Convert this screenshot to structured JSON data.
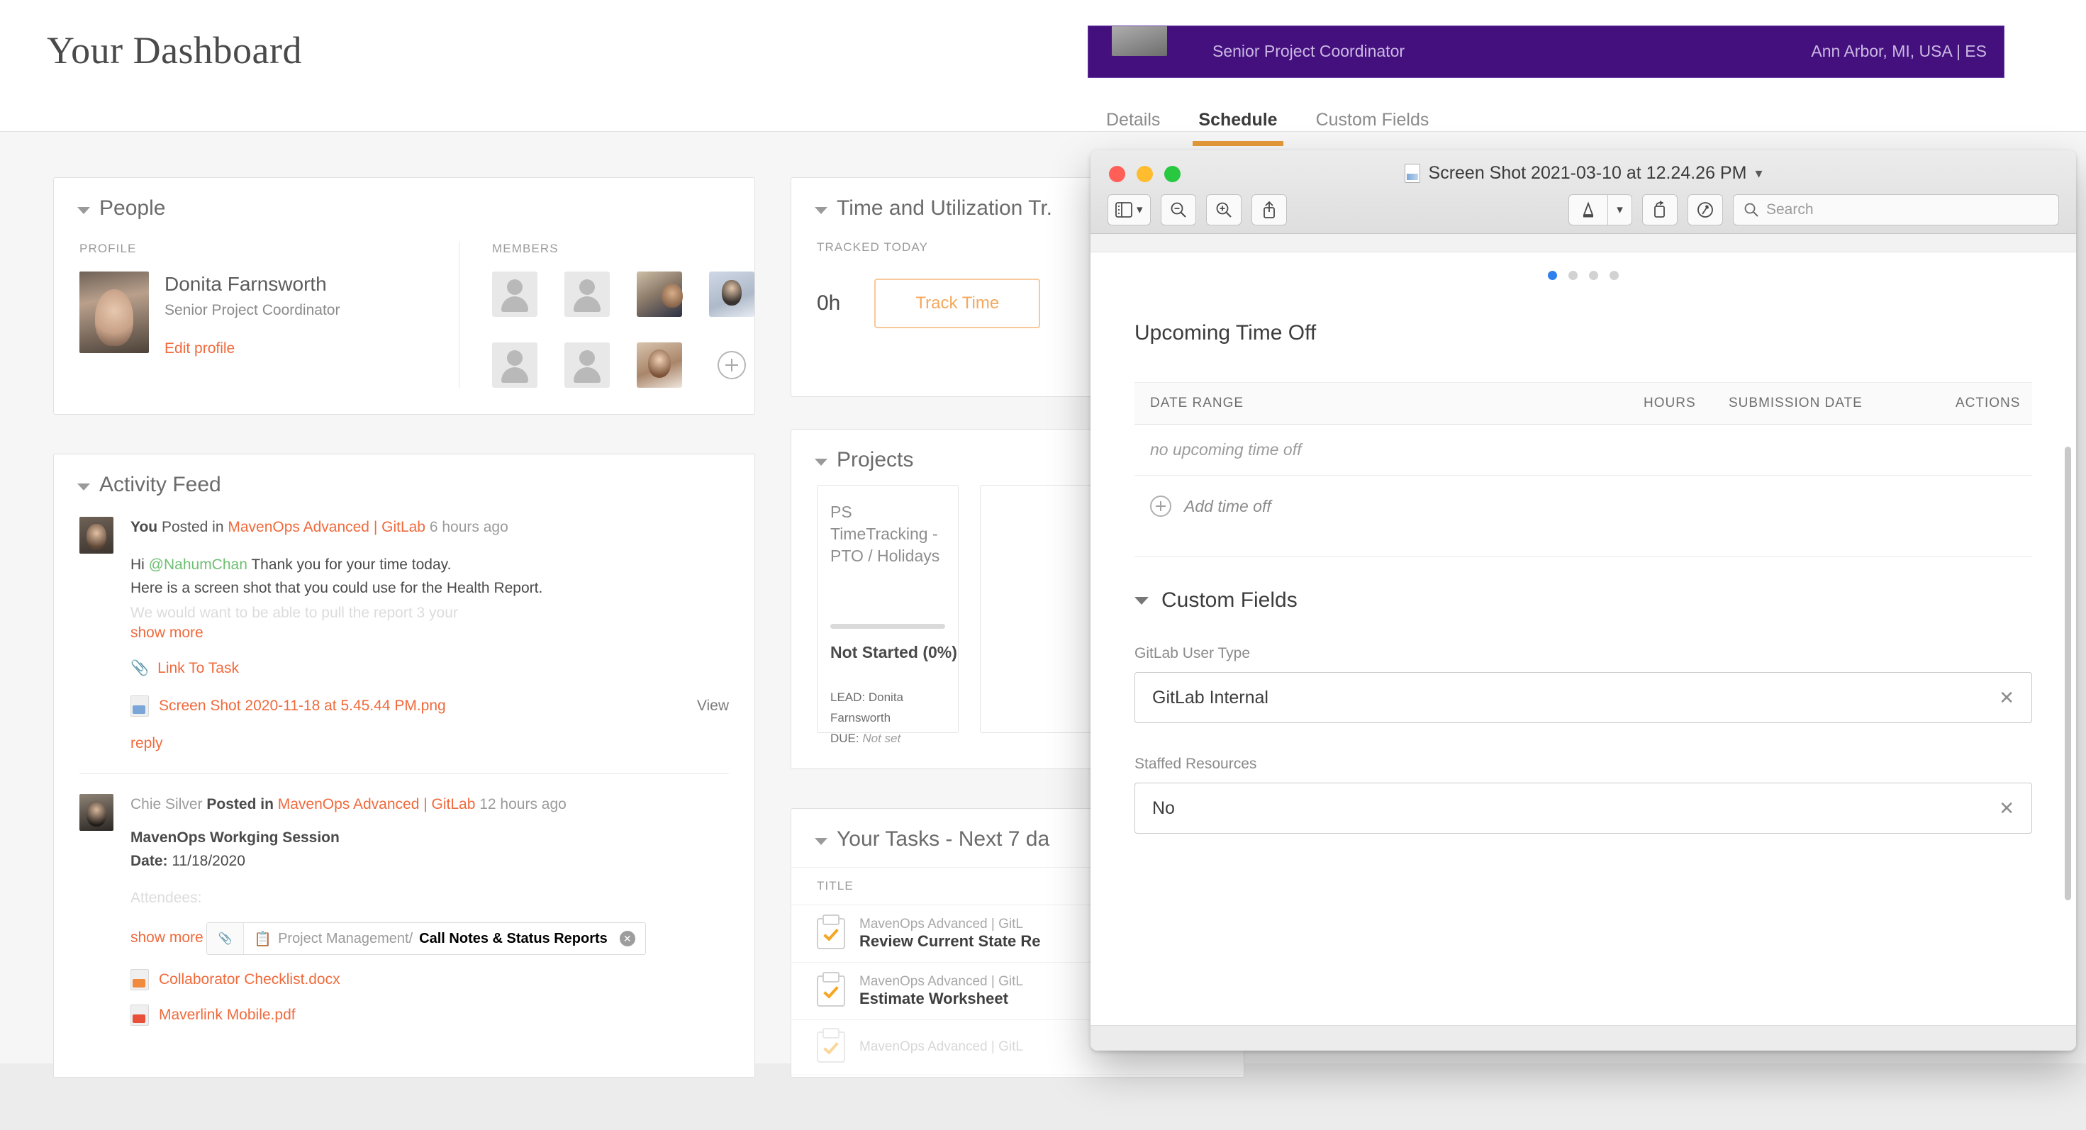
{
  "page": {
    "title": "Your Dashboard"
  },
  "people": {
    "card_title": "People",
    "profile_label": "PROFILE",
    "members_label": "MEMBERS",
    "name": "Donita Farnsworth",
    "role": "Senior Project Coordinator",
    "edit_link": "Edit profile",
    "add_member_icon": "plus-circle-icon"
  },
  "activity": {
    "card_title": "Activity Feed",
    "items": [
      {
        "actor": "You",
        "verb": "Posted in",
        "project": "MavenOps Advanced | GitLab",
        "time": "6 hours ago",
        "body_line1_prefix": "Hi ",
        "mention": "@NahumChan",
        "body_line1_suffix": " Thank you for your time today.",
        "body_line2": "Here is a screen shot that you could use for the Health Report.",
        "faded_line": "We would want to be able to pull the report 3 your",
        "show_more": "show more",
        "link_to_task": "Link To Task",
        "attachment": "Screen Shot 2020-11-18 at 5.45.44 PM.png",
        "view": "View",
        "reply": "reply"
      },
      {
        "actor": "Chie Silver",
        "verb": "Posted in",
        "project": "MavenOps Advanced | GitLab",
        "time": "12 hours ago",
        "title": "MavenOps Workging Session",
        "date_label": "Date:",
        "date_value": "11/18/2020",
        "faded_line": "Attendees:",
        "show_more": "show more",
        "chip_path": "Project Management/",
        "chip_task": "Call Notes & Status Reports",
        "files": [
          "Collaborator Checklist.docx",
          "Maverlink Mobile.pdf"
        ]
      }
    ]
  },
  "time_card": {
    "card_title": "Time and Utilization Tr.",
    "tracked_label": "TRACKED TODAY",
    "hours": "0h",
    "track_button": "Track Time"
  },
  "projects": {
    "card_title": "Projects",
    "items": [
      {
        "name": "PS TimeTracking - PTO / Holidays",
        "status": "Not Started (0%)",
        "progress_pct": 0,
        "lead_label": "LEAD:",
        "lead": "Donita Farnsworth",
        "due_label": "DUE:",
        "due": "Not set"
      }
    ]
  },
  "tasks": {
    "card_title": "Your Tasks - Next 7 da",
    "column_title": "TITLE",
    "rows": [
      {
        "project": "MavenOps Advanced | GitL",
        "name": "Review Current State Re"
      },
      {
        "project": "MavenOps Advanced | GitL",
        "name": "Estimate Worksheet"
      },
      {
        "project": "MavenOps Advanced | GitL",
        "name": ""
      }
    ]
  },
  "purple_header": {
    "role": "Senior Project Coordinator",
    "location": "Ann Arbor, MI, USA | ES",
    "color": "#43107e"
  },
  "maven_tabs": {
    "items": [
      {
        "label": "Details",
        "active": false
      },
      {
        "label": "Schedule",
        "active": true
      },
      {
        "label": "Custom Fields",
        "active": false
      }
    ],
    "active_underline_color": "#e59a3a"
  },
  "preview_window": {
    "title": "Screen Shot 2021-03-10 at 12.24.26 PM",
    "title_chevron": "chevron-down-icon",
    "traffic_lights": [
      "close-red",
      "minimize-yellow",
      "zoom-green"
    ],
    "toolbar": {
      "sidebar_button": "sidebar-icon",
      "zoom_out": "zoom-out-icon",
      "zoom_in": "zoom-in-icon",
      "share": "share-icon",
      "markup": "markup-pen-icon",
      "markup_chevron": "chevron-down-icon",
      "rotate": "rotate-icon",
      "annotate": "annotate-icon",
      "search_placeholder": "Search"
    }
  },
  "screenshot_content": {
    "dots_total": 4,
    "dots_active_index": 0,
    "time_off": {
      "heading": "Upcoming Time Off",
      "columns": [
        "DATE RANGE",
        "HOURS",
        "SUBMISSION DATE",
        "ACTIONS"
      ],
      "empty_text": "no upcoming time off",
      "add_label": "Add time off",
      "add_icon": "plus-circle-icon"
    },
    "custom_fields": {
      "heading": "Custom Fields",
      "fields": [
        {
          "label": "GitLab User Type",
          "value": "GitLab Internal",
          "clear_icon": "close-x-icon"
        },
        {
          "label": "Staffed Resources",
          "value": "No",
          "clear_icon": "close-x-icon"
        }
      ]
    }
  },
  "colors": {
    "accent_orange": "#f06a3c",
    "track_orange": "#f5a85c",
    "purple": "#43107e",
    "mention_green": "#6fbf73",
    "tab_underline": "#e59a3a"
  }
}
